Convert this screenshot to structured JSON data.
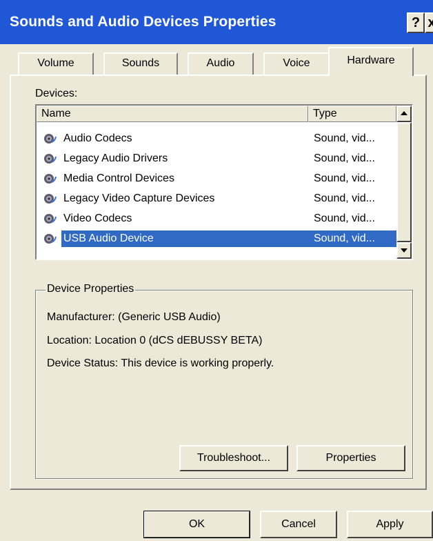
{
  "window": {
    "title": "Sounds and Audio Devices Properties",
    "help_label": "?",
    "close_label": "x"
  },
  "tabs": [
    {
      "label": "Volume",
      "active": false
    },
    {
      "label": "Sounds",
      "active": false
    },
    {
      "label": "Audio",
      "active": false
    },
    {
      "label": "Voice",
      "active": false
    },
    {
      "label": "Hardware",
      "active": true
    }
  ],
  "devices": {
    "label": "Devices:",
    "columns": {
      "name": "Name",
      "type": "Type"
    },
    "rows": [
      {
        "name": "Audio Codecs",
        "type": "Sound, vid...",
        "icon": "speaker-icon"
      },
      {
        "name": "Legacy Audio Drivers",
        "type": "Sound, vid...",
        "icon": "speaker-icon"
      },
      {
        "name": "Media Control Devices",
        "type": "Sound, vid...",
        "icon": "speaker-icon"
      },
      {
        "name": "Legacy Video Capture Devices",
        "type": "Sound, vid...",
        "icon": "speaker-icon"
      },
      {
        "name": "Video Codecs",
        "type": "Sound, vid...",
        "icon": "speaker-icon"
      },
      {
        "name": "USB Audio Device",
        "type": "Sound, vid...",
        "icon": "speaker-icon",
        "selected": true
      }
    ]
  },
  "device_properties": {
    "legend": "Device Properties",
    "manufacturer": "Manufacturer: (Generic USB Audio)",
    "location": "Location: Location 0 (dCS dEBUSSY BETA)",
    "status": "Device Status: This device is working properly.",
    "troubleshoot_label": "Troubleshoot...",
    "properties_label": "Properties"
  },
  "footer": {
    "ok_label": "OK",
    "cancel_label": "Cancel",
    "apply_label": "Apply"
  },
  "colors": {
    "titlebar": "#1f57d6",
    "selection": "#316ac5",
    "face": "#ece9d8"
  }
}
